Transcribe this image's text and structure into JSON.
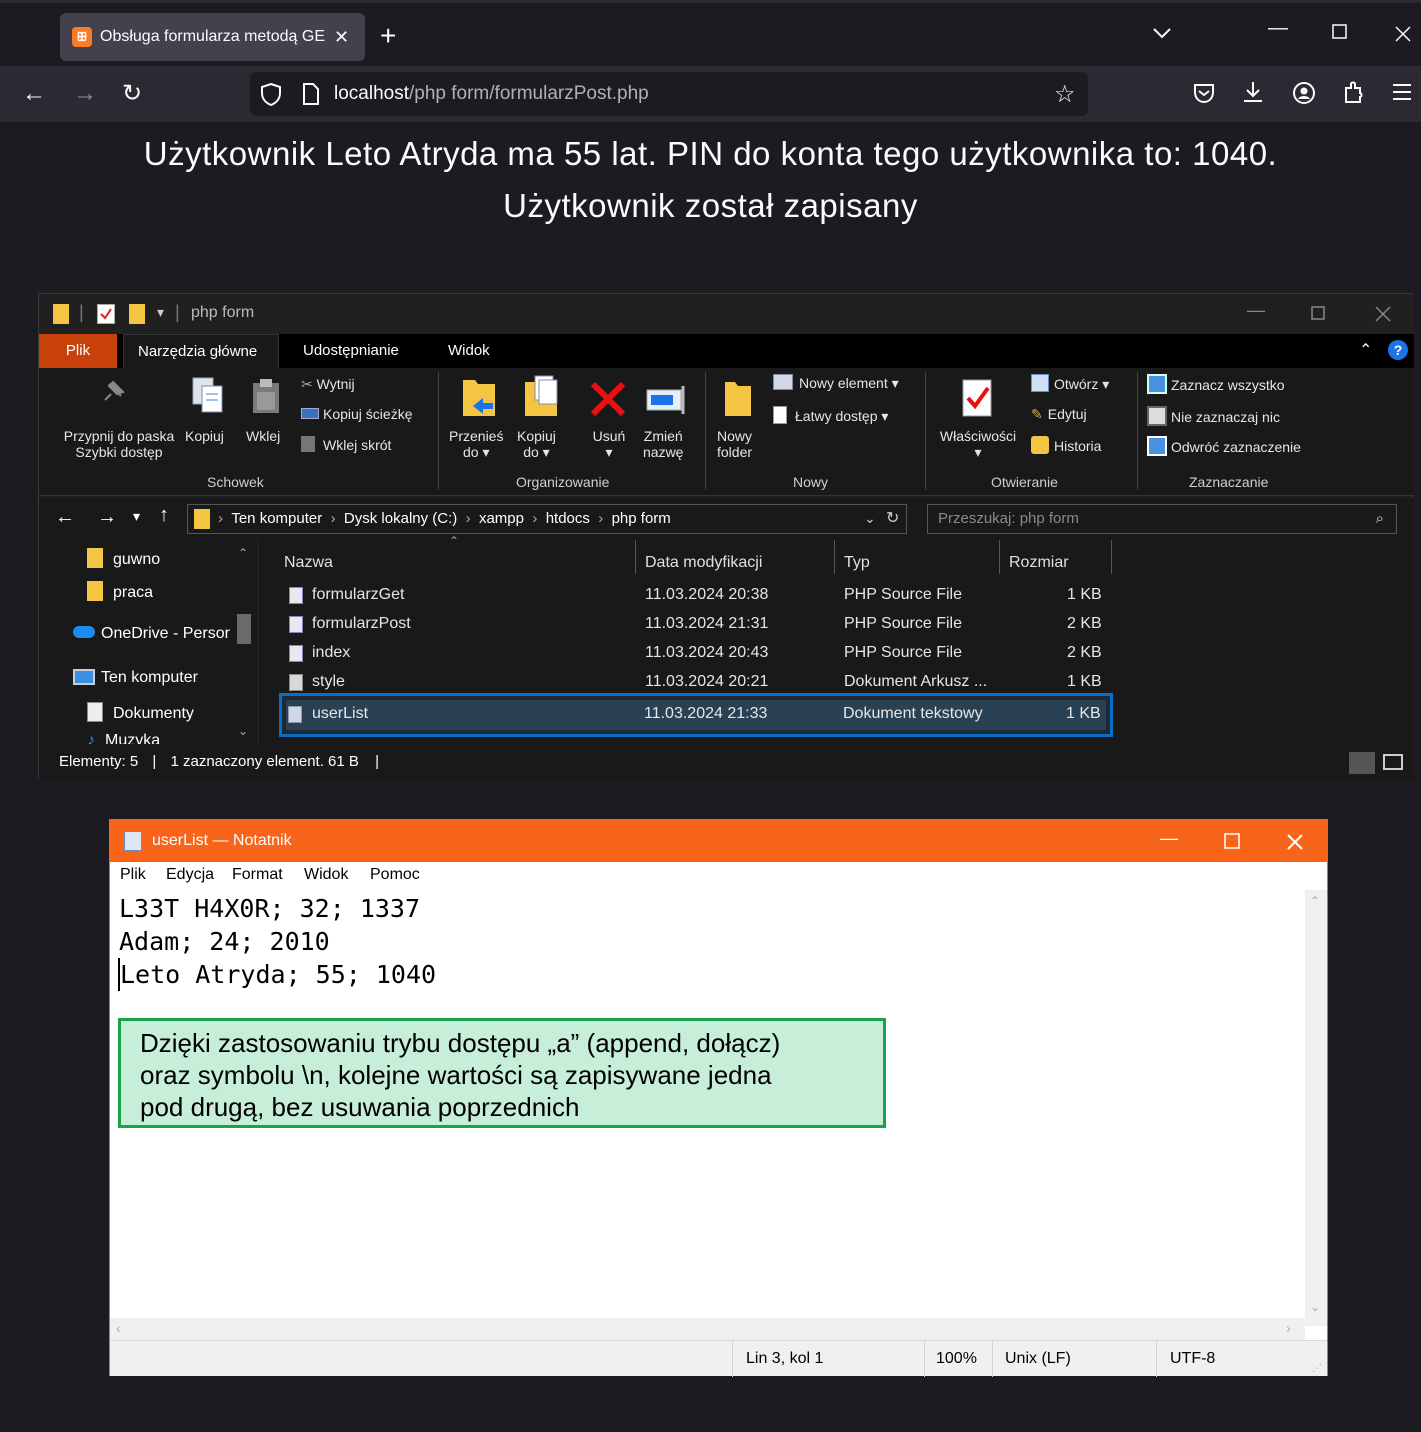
{
  "browser": {
    "tab_title": "Obsługa formularza metodą GE",
    "tab_close": "✕",
    "new_tab": "+",
    "url_host": "localhost",
    "url_path": "/php form/formularzPost.php"
  },
  "page": {
    "line1": "Użytkownik Leto Atryda ma 55 lat. PIN do konta tego użytkownika to: 1040.",
    "line2": "Użytkownik został zapisany"
  },
  "explorer": {
    "title": "php form",
    "ribbon_tabs": [
      "Plik",
      "Narzędzia główne",
      "Udostępnianie",
      "Widok"
    ],
    "ribbon": {
      "pin_line1": "Przypnij do paska",
      "pin_line2": "Szybki dostęp",
      "copy": "Kopiuj",
      "paste": "Wklej",
      "cut": "Wytnij",
      "copy_path": "Kopiuj ścieżkę",
      "paste_shortcut": "Wklej skrót",
      "group_clipboard": "Schowek",
      "move_line1": "Przenieś",
      "move_line2": "do ▾",
      "copyto_line1": "Kopiuj",
      "copyto_line2": "do ▾",
      "delete_line1": "Usuń",
      "delete_line2": "▾",
      "rename_line1": "Zmień",
      "rename_line2": "nazwę",
      "group_organize": "Organizowanie",
      "new_folder_line1": "Nowy",
      "new_folder_line2": "folder",
      "new_item": "Nowy element ▾",
      "easy_access": "Łatwy dostęp ▾",
      "group_new": "Nowy",
      "properties_line1": "Właściwości",
      "properties_line2": "▾",
      "open": "Otwórz ▾",
      "edit": "Edytuj",
      "history": "Historia",
      "group_open": "Otwieranie",
      "select_all": "Zaznacz wszystko",
      "select_none": "Nie zaznaczaj nic",
      "invert_selection": "Odwróć zaznaczenie",
      "group_select": "Zaznaczanie"
    },
    "breadcrumb": [
      "Ten komputer",
      "Dysk lokalny (C:)",
      "xampp",
      "htdocs",
      "php form"
    ],
    "search_placeholder": "Przeszukaj: php form",
    "nav": [
      "guwno",
      "praca",
      "OneDrive - Persor",
      "Ten komputer",
      "Dokumenty",
      "Muzyka"
    ],
    "columns": [
      "Nazwa",
      "Data modyfikacji",
      "Typ",
      "Rozmiar"
    ],
    "files": [
      {
        "name": "formularzGet",
        "date": "11.03.2024 20:38",
        "type": "PHP Source File",
        "size": "1 KB"
      },
      {
        "name": "formularzPost",
        "date": "11.03.2024 21:31",
        "type": "PHP Source File",
        "size": "2 KB"
      },
      {
        "name": "index",
        "date": "11.03.2024 20:43",
        "type": "PHP Source File",
        "size": "2 KB"
      },
      {
        "name": "style",
        "date": "11.03.2024 20:21",
        "type": "Dokument Arkusz ...",
        "size": "1 KB"
      },
      {
        "name": "userList",
        "date": "11.03.2024 21:33",
        "type": "Dokument tekstowy",
        "size": "1 KB"
      }
    ],
    "status_count": "Elementy: 5",
    "status_selected": "1 zaznaczony element. 61 B"
  },
  "notepad": {
    "title": "userList — Notatnik",
    "menu": [
      "Plik",
      "Edycja",
      "Format",
      "Widok",
      "Pomoc"
    ],
    "lines": [
      "L33T H4X0R; 32; 1337",
      "Adam; 24; 2010",
      "Leto Atryda; 55; 1040"
    ],
    "callout_lines": [
      "Dzięki zastosowaniu trybu dostępu „a” (append, dołącz)",
      "oraz symbolu \\n, kolejne wartości są zapisywane jedna",
      "pod drugą, bez usuwania poprzednich"
    ],
    "status_pos": "Lin 3, kol 1",
    "status_zoom": "100%",
    "status_eol": "Unix (LF)",
    "status_enc": "UTF-8"
  },
  "colors": {
    "firefox_bg": "#1c1b22",
    "notepad_accent": "#f8651a",
    "selection_border": "#0a6ec6",
    "callout_bg": "#c6eed8",
    "callout_border": "#1aa34a"
  }
}
